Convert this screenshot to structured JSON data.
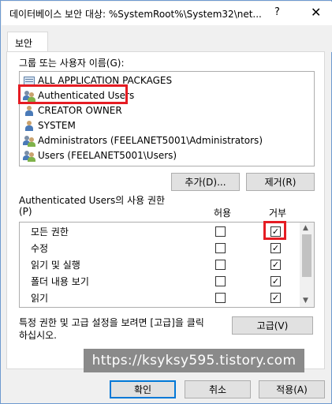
{
  "window": {
    "title": "데이터베이스 보안 대상: %SystemRoot%\\System32\\net...",
    "help_glyph": "?",
    "close_glyph": "✕"
  },
  "tabs": [
    {
      "label": "보안"
    }
  ],
  "principals": {
    "label": "그룹 또는 사용자 이름(G):",
    "items": [
      {
        "label": "ALL APPLICATION PACKAGES",
        "icon": "package-icon"
      },
      {
        "label": "Authenticated Users",
        "icon": "users-icon"
      },
      {
        "label": "CREATOR OWNER",
        "icon": "user-icon"
      },
      {
        "label": "SYSTEM",
        "icon": "user-icon"
      },
      {
        "label": "Administrators (FEELANET5001\\Administrators)",
        "icon": "users-icon"
      },
      {
        "label": "Users (FEELANET5001\\Users)",
        "icon": "users-icon"
      }
    ],
    "selected": "Authenticated Users"
  },
  "buttons": {
    "add": "추가(D)...",
    "remove": "제거(R)",
    "advanced": "고급(V)",
    "ok": "확인",
    "cancel": "취소",
    "apply": "적용(A)"
  },
  "permissions": {
    "title_line1": "Authenticated Users의 사용 권한",
    "title_line2": "(P)",
    "allow_header": "허용",
    "deny_header": "거부",
    "rows": [
      {
        "name": "모든 권한",
        "allow": false,
        "deny": true
      },
      {
        "name": "수정",
        "allow": false,
        "deny": true
      },
      {
        "name": "읽기 및 실행",
        "allow": false,
        "deny": true
      },
      {
        "name": "폴더 내용 보기",
        "allow": false,
        "deny": true
      },
      {
        "name": "읽기",
        "allow": false,
        "deny": true
      }
    ]
  },
  "advanced_hint": {
    "line1": "특정 권한 및 고급 설정을 보려면 [고급]을 클릭",
    "line2": "하십시오."
  },
  "watermark": "https://ksyksy595.tistory.com",
  "colors": {
    "highlight_border": "#e51c23",
    "accent": "#0078d7"
  }
}
